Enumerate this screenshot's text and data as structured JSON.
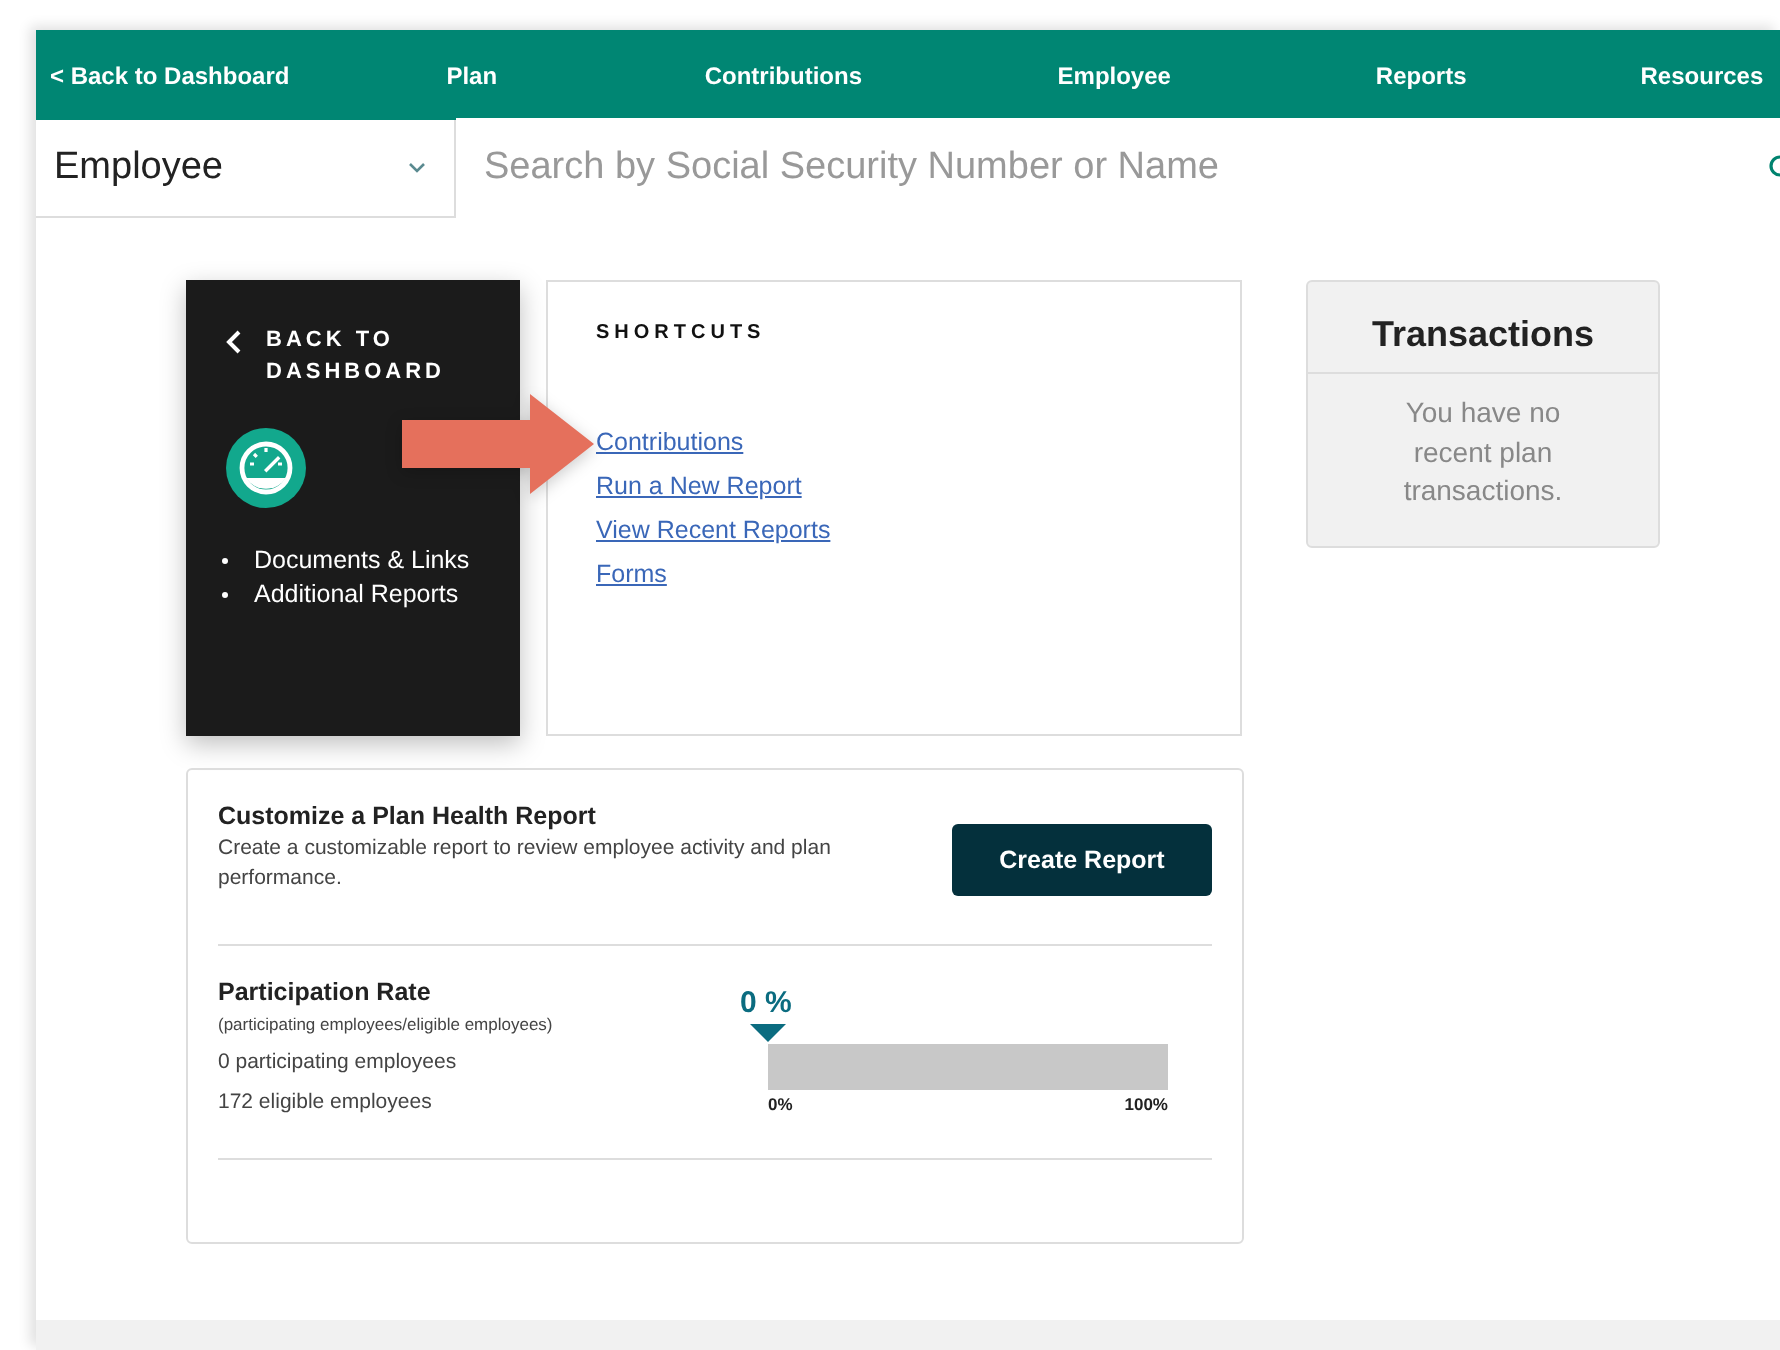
{
  "nav": {
    "back": "< Back to Dashboard",
    "items": [
      {
        "label": "Plan",
        "selected": false
      },
      {
        "label": "Contributions",
        "selected": false
      },
      {
        "label": "Employee",
        "selected": false
      },
      {
        "label": "Reports",
        "selected": false
      },
      {
        "label": "Resources",
        "selected": false
      }
    ]
  },
  "search": {
    "scope": "Employee",
    "placeholder": "Search by Social Security Number or Name"
  },
  "side_card": {
    "back": "BACK TO DASHBOARD",
    "links": [
      "Documents & Links",
      "Additional Reports"
    ]
  },
  "shortcuts": {
    "title": "SHORTCUTS",
    "links": [
      "Contributions",
      "Run a New Report",
      "View Recent Reports",
      "Forms"
    ]
  },
  "transactions": {
    "title": "Transactions",
    "message": "You have no recent plan transactions."
  },
  "health": {
    "title": "Customize a Plan Health Report",
    "description": "Create a customizable report to review employee activity and plan performance.",
    "button": "Create Report"
  },
  "participation": {
    "title": "Participation Rate",
    "subtitle": "(participating employees/eligible employees)",
    "participating": "0 participating employees",
    "eligible": "172 eligible employees",
    "value": "0 %",
    "min_label": "0%",
    "max_label": "100%"
  }
}
